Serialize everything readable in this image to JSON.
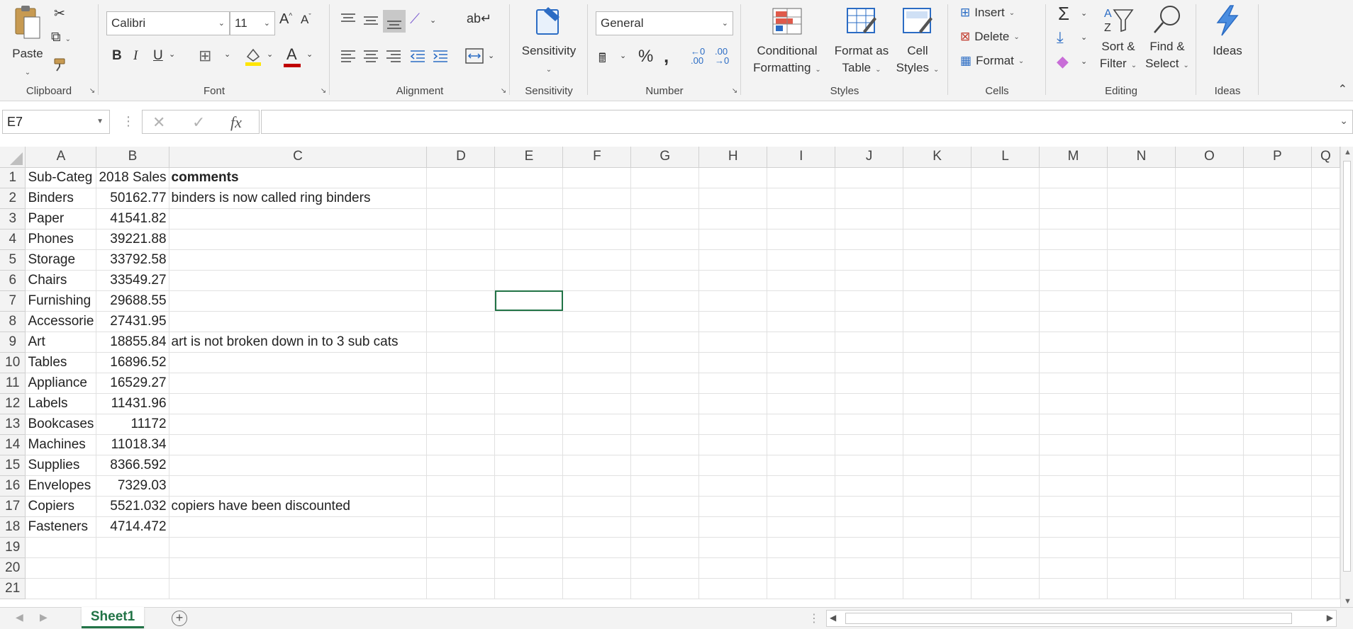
{
  "ribbon": {
    "clipboard": {
      "label": "Clipboard",
      "paste_label": "Paste"
    },
    "font": {
      "label": "Font",
      "font_name": "Calibri",
      "font_size": "11",
      "bold": "B",
      "italic": "I",
      "underline": "U",
      "font_color_letter": "A",
      "increase_font": "A˄",
      "decrease_font": "A˅",
      "fill_color": "#FFE500",
      "font_color": "#C00000"
    },
    "alignment": {
      "label": "Alignment"
    },
    "sensitivity": {
      "label": "Sensitivity",
      "button_label": "Sensitivity"
    },
    "number": {
      "label": "Number",
      "format": "General"
    },
    "styles": {
      "label": "Styles",
      "conditional_1": "Conditional",
      "conditional_2": "Formatting",
      "format_table_1": "Format as",
      "format_table_2": "Table",
      "cell_styles_1": "Cell",
      "cell_styles_2": "Styles"
    },
    "cells": {
      "label": "Cells",
      "insert": "Insert",
      "delete": "Delete",
      "format": "Format"
    },
    "editing": {
      "label": "Editing",
      "sort_1": "Sort &",
      "sort_2": "Filter",
      "find_1": "Find &",
      "find_2": "Select"
    },
    "ideas": {
      "label": "Ideas",
      "button_label": "Ideas"
    }
  },
  "formula_bar": {
    "name_box": "E7",
    "fx": "fx",
    "formula": ""
  },
  "columns": [
    "A",
    "B",
    "C",
    "D",
    "E",
    "F",
    "G",
    "H",
    "I",
    "J",
    "K",
    "L",
    "M",
    "N",
    "O",
    "P",
    "Q"
  ],
  "column_widths": {},
  "rows": [
    {
      "n": "1",
      "a": "Sub-Categ",
      "b": "2018 Sales",
      "c": "comments"
    },
    {
      "n": "2",
      "a": "Binders",
      "b": "50162.77",
      "c": "binders is now called ring binders"
    },
    {
      "n": "3",
      "a": "Paper",
      "b": "41541.82",
      "c": ""
    },
    {
      "n": "4",
      "a": "Phones",
      "b": "39221.88",
      "c": ""
    },
    {
      "n": "5",
      "a": "Storage",
      "b": "33792.58",
      "c": ""
    },
    {
      "n": "6",
      "a": "Chairs",
      "b": "33549.27",
      "c": ""
    },
    {
      "n": "7",
      "a": "Furnishing",
      "b": "29688.55",
      "c": ""
    },
    {
      "n": "8",
      "a": "Accessorie",
      "b": "27431.95",
      "c": ""
    },
    {
      "n": "9",
      "a": "Art",
      "b": "18855.84",
      "c": "art is not broken down in to 3 sub cats"
    },
    {
      "n": "10",
      "a": "Tables",
      "b": "16896.52",
      "c": ""
    },
    {
      "n": "11",
      "a": "Appliance",
      "b": "16529.27",
      "c": ""
    },
    {
      "n": "12",
      "a": "Labels",
      "b": "11431.96",
      "c": ""
    },
    {
      "n": "13",
      "a": "Bookcases",
      "b": "11172",
      "c": ""
    },
    {
      "n": "14",
      "a": "Machines",
      "b": "11018.34",
      "c": ""
    },
    {
      "n": "15",
      "a": "Supplies",
      "b": "8366.592",
      "c": ""
    },
    {
      "n": "16",
      "a": "Envelopes",
      "b": "7329.03",
      "c": ""
    },
    {
      "n": "17",
      "a": "Copiers",
      "b": "5521.032",
      "c": "copiers have been discounted"
    },
    {
      "n": "18",
      "a": "Fasteners",
      "b": "4714.472",
      "c": ""
    },
    {
      "n": "19",
      "a": "",
      "b": "",
      "c": ""
    },
    {
      "n": "20",
      "a": "",
      "b": "",
      "c": ""
    },
    {
      "n": "21",
      "a": "",
      "b": "",
      "c": ""
    }
  ],
  "sheet_tabs": [
    "Sheet1"
  ],
  "colors": {
    "accent": "#217346"
  }
}
